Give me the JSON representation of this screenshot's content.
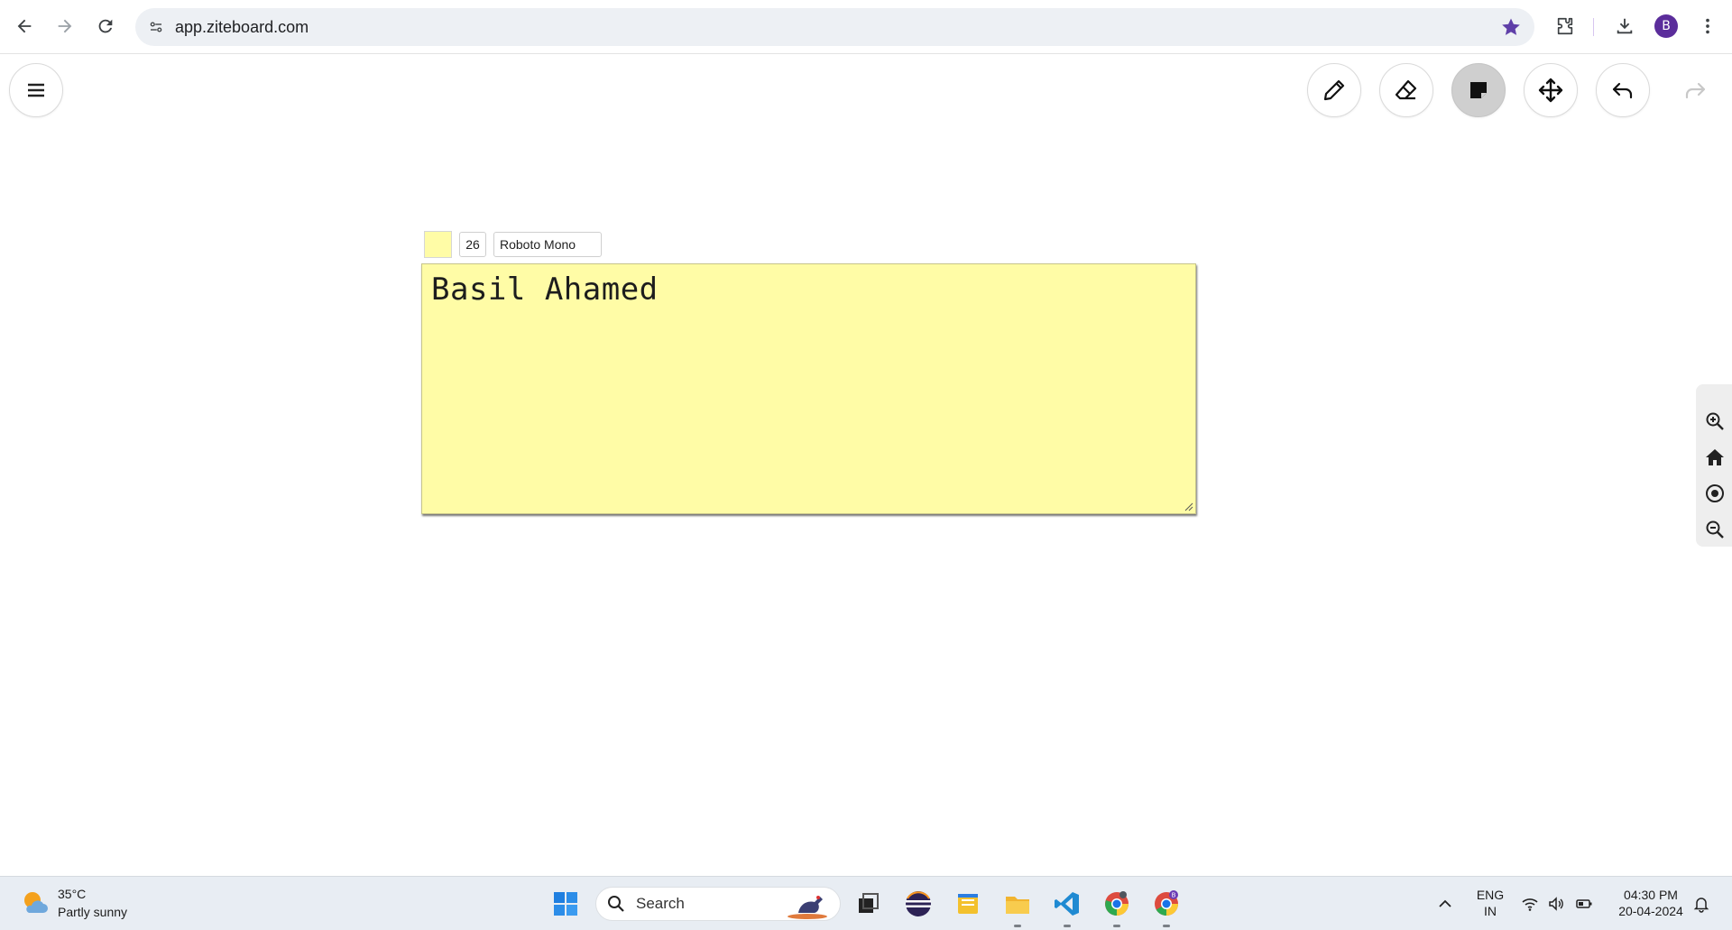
{
  "browser": {
    "url": "app.ziteboard.com",
    "profile_initial": "B"
  },
  "toolbar": {
    "menu_icon": "hamburger-icon",
    "tools": [
      {
        "name": "pencil",
        "icon": "pencil-icon",
        "active": false
      },
      {
        "name": "eraser",
        "icon": "eraser-icon",
        "active": false
      },
      {
        "name": "sticky-note",
        "icon": "sticky-note-icon",
        "active": true
      },
      {
        "name": "move",
        "icon": "move-icon",
        "active": false
      },
      {
        "name": "undo",
        "icon": "undo-icon",
        "active": false
      },
      {
        "name": "redo",
        "icon": "redo-icon",
        "active": false
      }
    ]
  },
  "note": {
    "color": "#fffca6",
    "font_size": "26",
    "font_family": "Roboto Mono",
    "text": "Basil Ahamed"
  },
  "zoom_panel": {
    "buttons": [
      "zoom-in-icon",
      "home-icon",
      "center-icon",
      "zoom-out-icon"
    ]
  },
  "taskbar": {
    "weather_temp": "35°C",
    "weather_desc": "Partly sunny",
    "search_label": "Search",
    "language_line1": "ENG",
    "language_line2": "IN",
    "time": "04:30 PM",
    "date": "20-04-2024",
    "pinned_apps": [
      "windows-start-icon",
      "task-view-icon",
      "eclipse-icon",
      "notes-app-icon",
      "file-explorer-icon",
      "vscode-icon",
      "chrome-icon",
      "chrome-profile-icon"
    ]
  },
  "colors": {
    "note_yellow": "#fffca6",
    "active_tool_bg": "#cfcfcf",
    "taskbar_bg": "#e8edf3"
  }
}
